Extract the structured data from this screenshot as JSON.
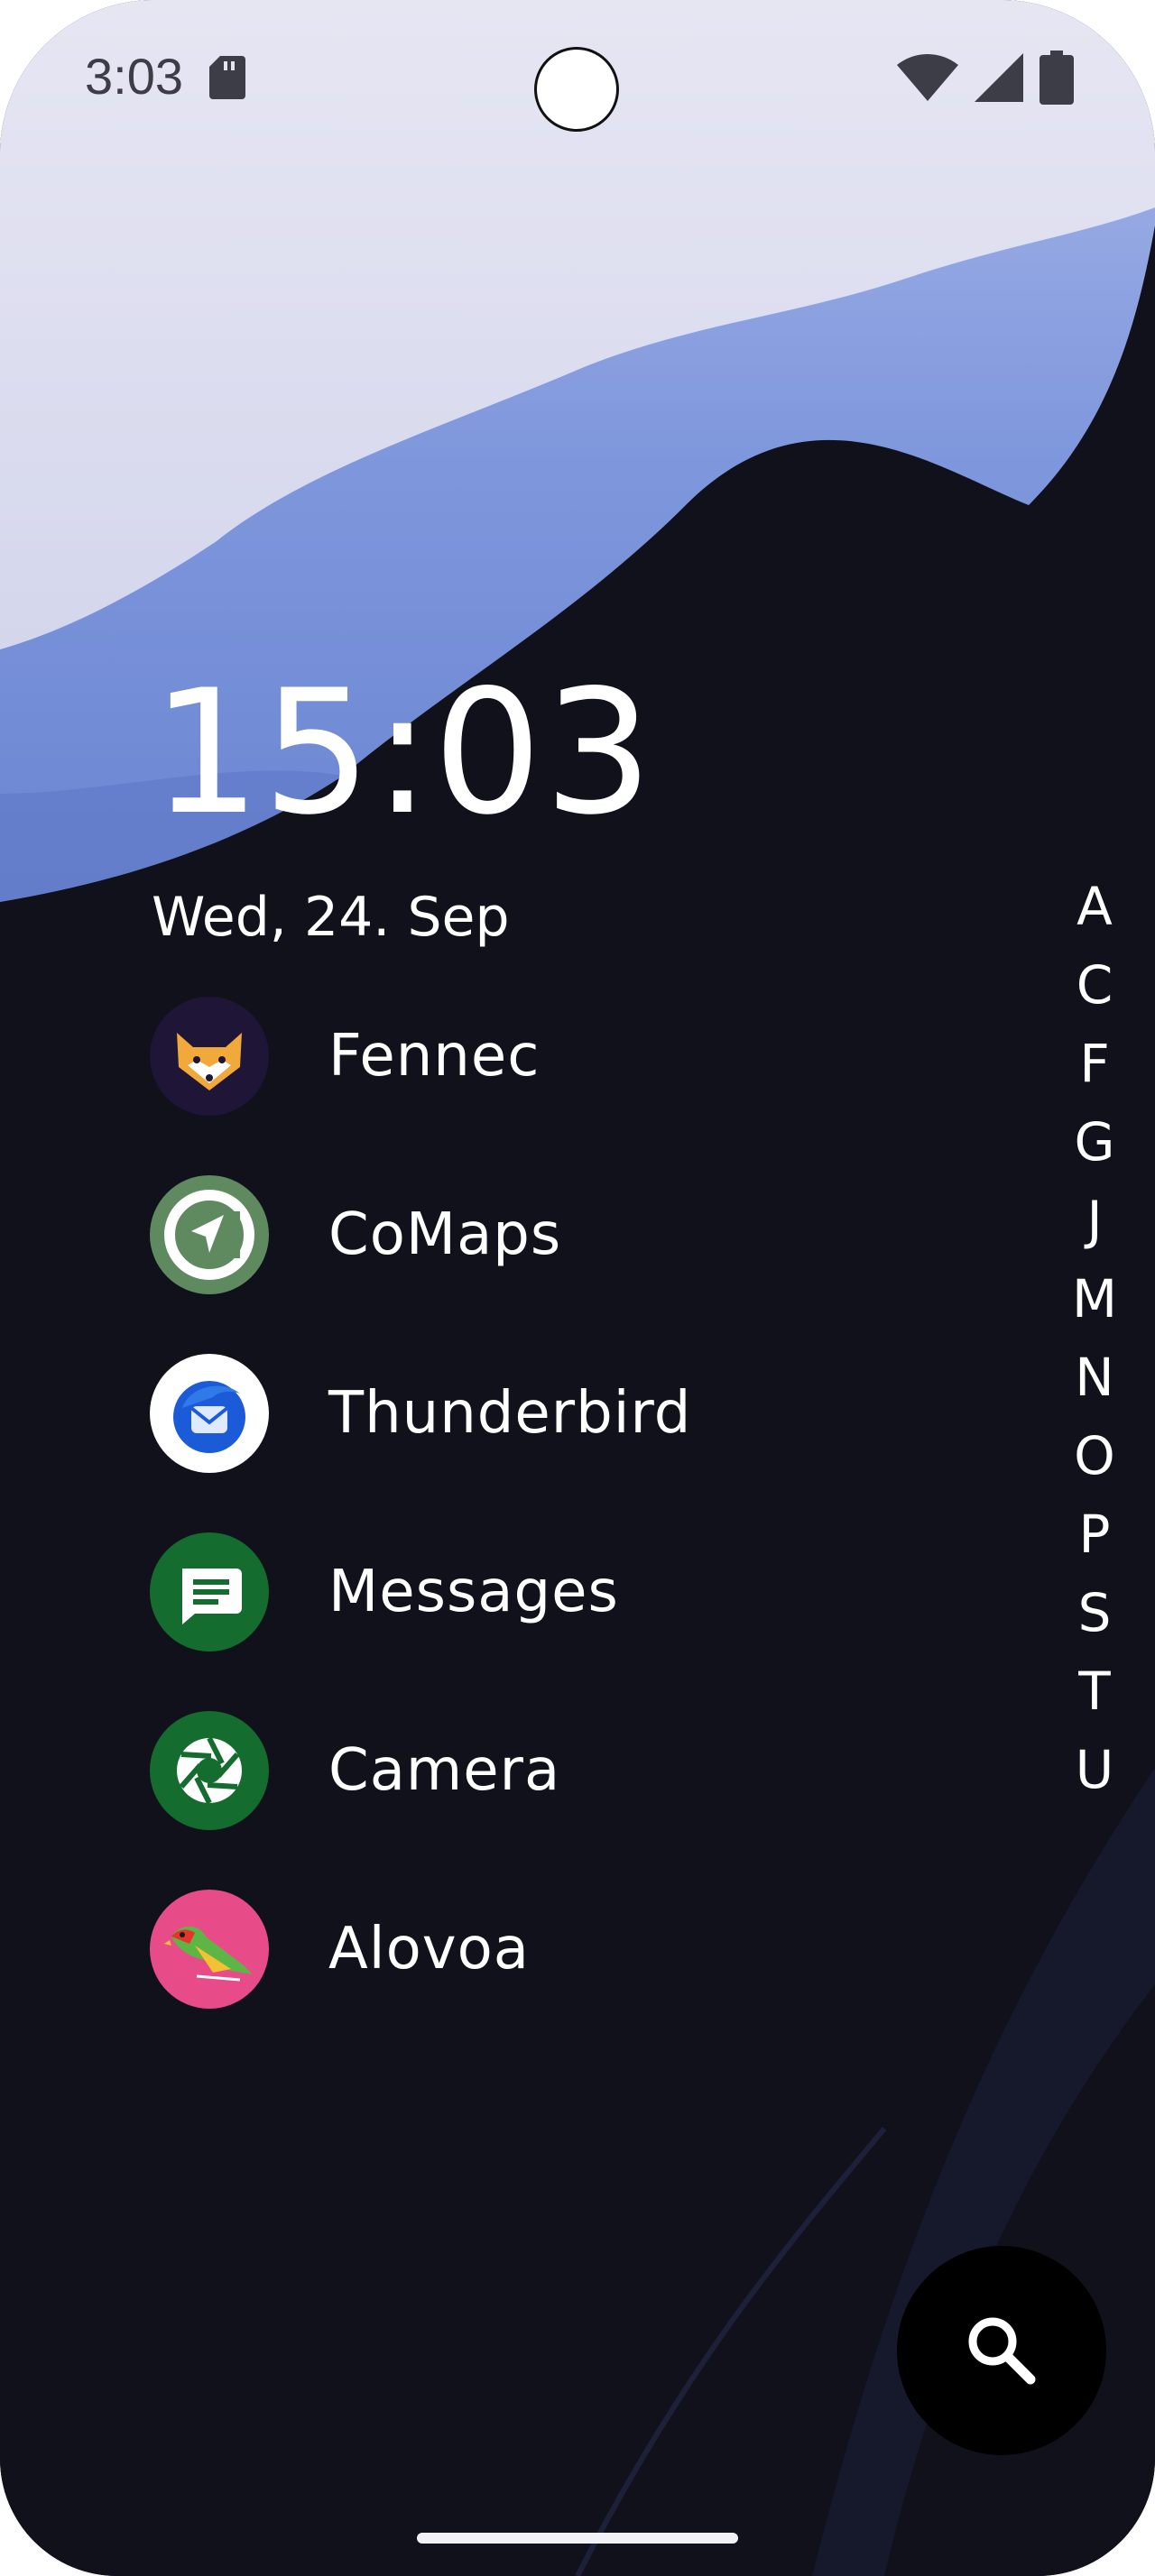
{
  "status_bar": {
    "time": "3:03"
  },
  "clock": {
    "time": "15:03",
    "date": "Wed, 24. Sep"
  },
  "apps": [
    {
      "label": "Fennec",
      "icon": "fennec-icon"
    },
    {
      "label": "CoMaps",
      "icon": "comaps-icon"
    },
    {
      "label": "Thunderbird",
      "icon": "thunderbird-icon"
    },
    {
      "label": "Messages",
      "icon": "messages-icon"
    },
    {
      "label": "Camera",
      "icon": "camera-icon"
    },
    {
      "label": "Alovoa",
      "icon": "alovoa-icon"
    }
  ],
  "alphabet_index": [
    "A",
    "C",
    "F",
    "G",
    "J",
    "M",
    "N",
    "O",
    "P",
    "S",
    "T",
    "U"
  ],
  "colors": {
    "background": "#11111c",
    "sky": "#e4e4f2",
    "wave": "#8aa0dc",
    "messages_green": "#146c2e",
    "alovoa_pink": "#e84c88"
  }
}
